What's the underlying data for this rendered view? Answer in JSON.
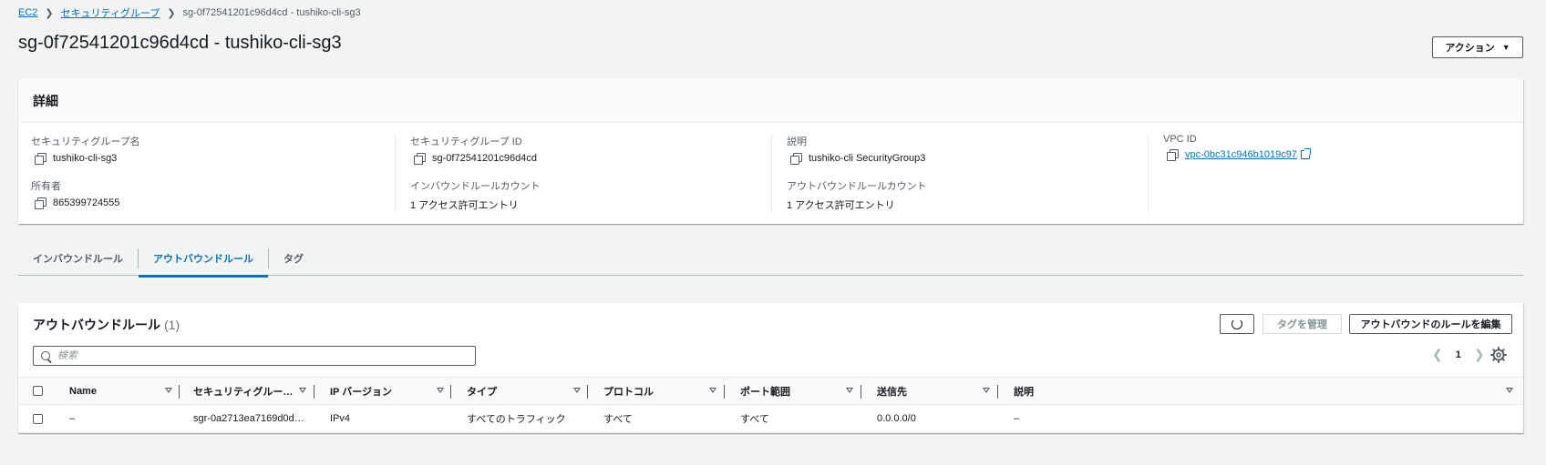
{
  "breadcrumb": {
    "root": "EC2",
    "parent": "セキュリティグループ",
    "current": "sg-0f72541201c96d4cd - tushiko-cli-sg3"
  },
  "page": {
    "title": "sg-0f72541201c96d4cd - tushiko-cli-sg3",
    "actions_label": "アクション"
  },
  "details": {
    "header": "詳細",
    "sg_name": {
      "label": "セキュリティグループ名",
      "value": "tushiko-cli-sg3"
    },
    "sg_id": {
      "label": "セキュリティグループ ID",
      "value": "sg-0f72541201c96d4cd"
    },
    "description": {
      "label": "説明",
      "value": "tushiko-cli SecurityGroup3"
    },
    "vpc_id": {
      "label": "VPC ID",
      "value": "vpc-0bc31c946b1019c97"
    },
    "owner": {
      "label": "所有者",
      "value": "865399724555"
    },
    "inbound_count": {
      "label": "インバウンドルールカウント",
      "value": "1 アクセス許可エントリ"
    },
    "outbound_count": {
      "label": "アウトバウンドルールカウント",
      "value": "1 アクセス許可エントリ"
    }
  },
  "tabs": [
    {
      "label": "インバウンドルール",
      "active": false
    },
    {
      "label": "アウトバウンドルール",
      "active": true
    },
    {
      "label": "タグ",
      "active": false
    }
  ],
  "rules": {
    "title": "アウトバウンドルール",
    "count": "(1)",
    "manage_tags_label": "タグを管理",
    "edit_label": "アウトバウンドのルールを編集",
    "search_placeholder": "検索",
    "page_number": "1",
    "columns": [
      "Name",
      "セキュリティグルー…",
      "IP バージョン",
      "タイプ",
      "プロトコル",
      "ポート範囲",
      "送信先",
      "説明"
    ],
    "rows": [
      [
        "–",
        "sgr-0a2713ea7169d0d…",
        "IPv4",
        "すべてのトラフィック",
        "すべて",
        "すべて",
        "0.0.0.0/0",
        "–"
      ]
    ]
  },
  "icons": {
    "breadcrumb_separator": "chevron-right-icon",
    "copy": "copy-icon",
    "external": "external-link-icon",
    "refresh": "refresh-icon",
    "search": "search-icon",
    "settings": "gear-icon"
  },
  "colors": {
    "accent": "#0073bb",
    "background": "#f2f3f3",
    "text": "#16191f",
    "muted": "#545b64"
  }
}
